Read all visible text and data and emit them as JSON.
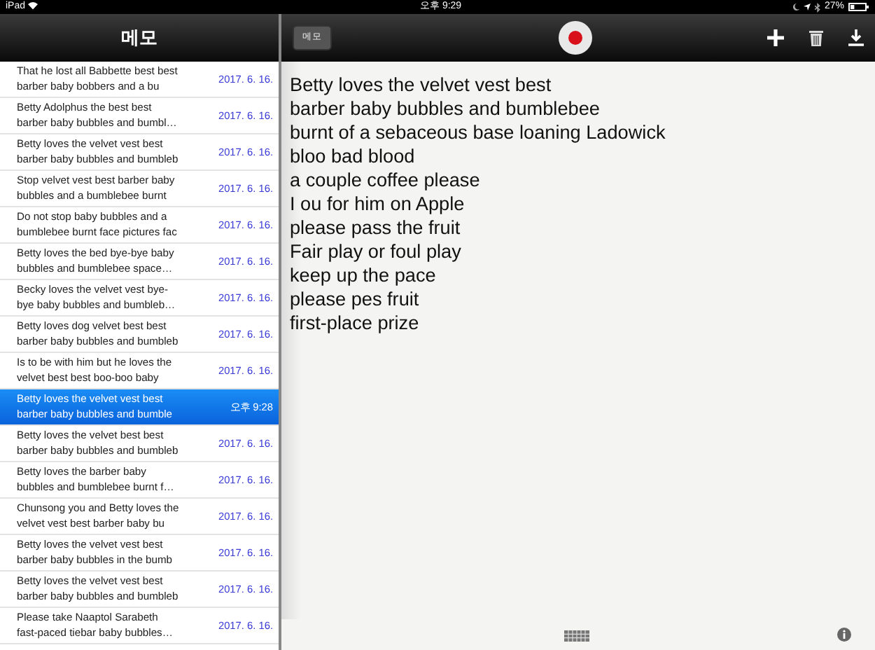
{
  "status_bar": {
    "device": "iPad",
    "time": "오후 9:29",
    "battery": "27%"
  },
  "sidebar": {
    "title": "메모",
    "notes": [
      {
        "lines": [
          "That he lost all Babbette best best",
          "barber baby bobbers and a bu"
        ],
        "date": "2017. 6. 16.",
        "selected": false
      },
      {
        "lines": [
          "Betty Adolphus the best best",
          "barber baby bubbles and bumbl…"
        ],
        "date": "2017. 6. 16.",
        "selected": false
      },
      {
        "lines": [
          "Betty loves the velvet vest best",
          "barber baby bubbles and bumbleb"
        ],
        "date": "2017. 6. 16.",
        "selected": false
      },
      {
        "lines": [
          "Stop velvet vest best barber baby",
          "bubbles and a bumblebee burnt"
        ],
        "date": "2017. 6. 16.",
        "selected": false
      },
      {
        "lines": [
          "Do not stop baby bubbles and a",
          "bumblebee burnt face pictures fac"
        ],
        "date": "2017. 6. 16.",
        "selected": false
      },
      {
        "lines": [
          "Betty loves the bed bye-bye baby",
          "bubbles and bumblebee space…"
        ],
        "date": "2017. 6. 16.",
        "selected": false
      },
      {
        "lines": [
          "Becky loves the velvet vest bye-",
          "bye baby bubbles and bumbleb…"
        ],
        "date": "2017. 6. 16.",
        "selected": false
      },
      {
        "lines": [
          "Betty loves dog velvet best best",
          "barber baby bubbles and bumbleb"
        ],
        "date": "2017. 6. 16.",
        "selected": false
      },
      {
        "lines": [
          "Is to be with him but he loves the",
          "velvet best best boo-boo baby"
        ],
        "date": "2017. 6. 16.",
        "selected": false
      },
      {
        "lines": [
          "Betty loves the velvet vest best",
          "barber baby bubbles and bumble"
        ],
        "date": "오후 9:28",
        "selected": true
      },
      {
        "lines": [
          "Betty loves the velvet best best",
          "barber baby bubbles and bumbleb"
        ],
        "date": "2017. 6. 16.",
        "selected": false
      },
      {
        "lines": [
          "Betty loves the barber baby",
          "bubbles and bumblebee burnt f…"
        ],
        "date": "2017. 6. 16.",
        "selected": false
      },
      {
        "lines": [
          "Chunsong you and Betty loves the",
          "velvet vest best barber baby bu"
        ],
        "date": "2017. 6. 16.",
        "selected": false
      },
      {
        "lines": [
          "Betty loves the velvet vest best",
          "barber baby bubbles in the bumb"
        ],
        "date": "2017. 6. 16.",
        "selected": false
      },
      {
        "lines": [
          "Betty loves the velvet vest best",
          "barber baby bubbles and bumbleb"
        ],
        "date": "2017. 6. 16.",
        "selected": false
      },
      {
        "lines": [
          "Please take Naaptol Sarabeth",
          "fast-paced tiebar baby bubbles…"
        ],
        "date": "2017. 6. 16.",
        "selected": false
      }
    ]
  },
  "editor": {
    "back_button": "메모",
    "lines": [
      "Betty loves the velvet vest best",
      "barber baby bubbles and bumblebee",
      "burnt of a sebaceous base loaning Ladowick",
      "bloo bad blood",
      "a couple coffee please",
      "I ou for him on Apple",
      "please pass the fruit",
      "Fair play or foul play",
      "keep up the pace",
      "please pes fruit",
      "first-place prize"
    ]
  }
}
